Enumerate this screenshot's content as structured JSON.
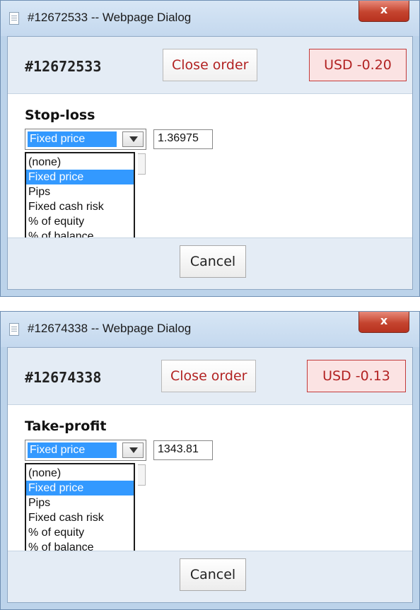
{
  "dialogs": [
    {
      "window_title": "#12672533 -- Webpage Dialog",
      "close_glyph": "x",
      "order_id": "#12672533",
      "close_order_label": "Close order",
      "pnl": "USD -0.20",
      "section_label": "Stop-loss",
      "select_value": "Fixed price",
      "price_value": "1.36975",
      "options": [
        "(none)",
        "Fixed price",
        "Pips",
        "Fixed cash risk",
        "% of equity",
        "% of balance"
      ],
      "selected_option": "Fixed price",
      "cancel_label": "Cancel"
    },
    {
      "window_title": "#12674338 -- Webpage Dialog",
      "close_glyph": "x",
      "order_id": "#12674338",
      "close_order_label": "Close order",
      "pnl": "USD -0.13",
      "section_label": "Take-profit",
      "select_value": "Fixed price",
      "price_value": "1343.81",
      "options": [
        "(none)",
        "Fixed price",
        "Pips",
        "Fixed cash risk",
        "% of equity",
        "% of balance"
      ],
      "selected_option": "Fixed price",
      "cancel_label": "Cancel"
    }
  ],
  "colors": {
    "accent_select": "#3399ff",
    "loss_text": "#b22222",
    "loss_bg": "#fbe3e3",
    "close_button": "#c5442f"
  },
  "icons": {
    "page": "page-icon",
    "close": "close-icon",
    "dropdown": "chevron-down-icon"
  }
}
